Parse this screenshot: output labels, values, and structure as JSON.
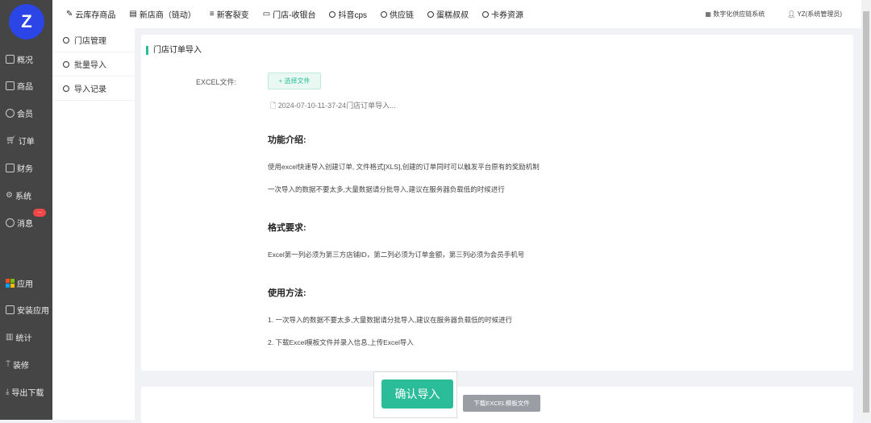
{
  "sidebar": {
    "items": [
      {
        "label": "概况"
      },
      {
        "label": "商品"
      },
      {
        "label": "会员"
      },
      {
        "label": "订单"
      },
      {
        "label": "财务"
      },
      {
        "label": "系统"
      },
      {
        "label": "消息"
      },
      {
        "label": "应用"
      },
      {
        "label": "安装应用"
      },
      {
        "label": "统计"
      },
      {
        "label": "装修"
      },
      {
        "label": "导出下载"
      }
    ],
    "badge": "..."
  },
  "topnav": {
    "items": [
      "云库存商品",
      "新店商（链动）",
      "新客裂变",
      "门店-收银台",
      "抖音cps",
      "供应链",
      "蛋糕叔叔",
      "卡券资源"
    ],
    "system": "数字化供应链系统",
    "user": "YZ(系统管理员)"
  },
  "submenu": {
    "items": [
      "门店管理",
      "批量导入",
      "导入记录"
    ]
  },
  "main": {
    "title": "门店订单导入",
    "excel_label": "EXCEL文件:",
    "choose_file": "+ 选择文件",
    "file_name": "2024-07-10-11-37-24门店订单导入...",
    "sections": [
      {
        "heading": "功能介绍:",
        "lines": [
          "使用excel快速导入创建订单, 文件格式[XLS],创建的订单同时可以触发平台原有的奖励机制",
          "一次导入的数据不要太多,大量数据请分批导入,建议在服务器负载低的时候进行"
        ]
      },
      {
        "heading": "格式要求:",
        "lines": [
          "Excel第一列必须为第三方店铺ID，第二列必须为订单金额，第三列必须为会员手机号"
        ]
      },
      {
        "heading": "使用方法:",
        "lines": [
          "1. 一次导入的数据不要太多,大量数据请分批导入,建议在服务器负载低的时候进行",
          "2. 下载Excel模板文件并录入信息,上传Excel导入"
        ]
      }
    ],
    "confirm": "确认导入",
    "download": "下载EXCEL模板文件"
  },
  "colors": {
    "accent": "#2bbd9a",
    "sidebar": "#454545",
    "logo": "#2b45e6"
  }
}
